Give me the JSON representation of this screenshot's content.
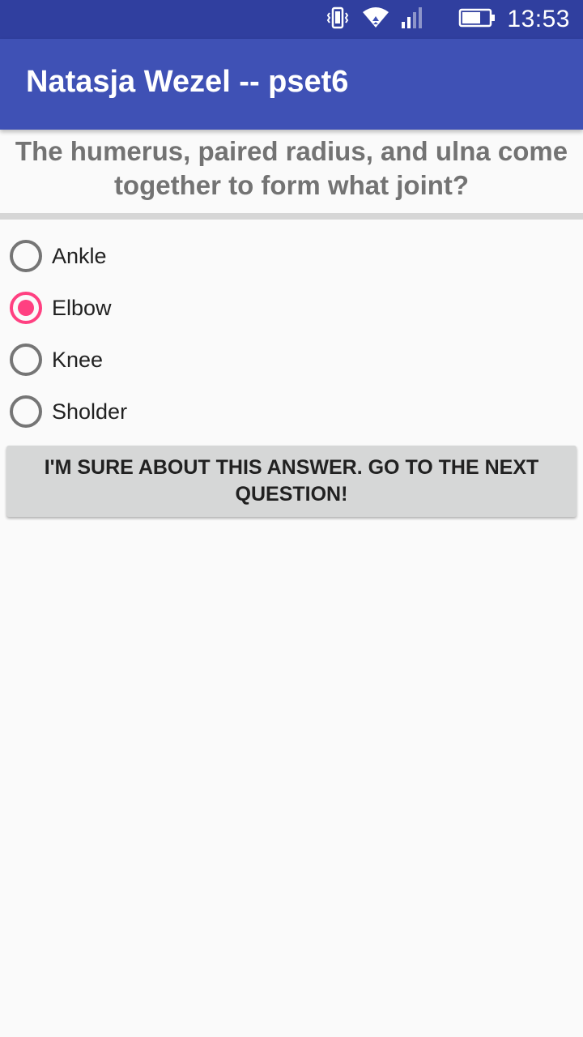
{
  "status_bar": {
    "time": "13:53",
    "icons": [
      "vibrate-icon",
      "wifi-icon",
      "signal-icon",
      "battery-icon"
    ]
  },
  "app_bar": {
    "title": "Natasja Wezel -- pset6"
  },
  "question": {
    "text": "The humerus, paired radius, and ulna come together to form what joint?"
  },
  "options": [
    {
      "label": "Ankle",
      "checked": false
    },
    {
      "label": "Elbow",
      "checked": true
    },
    {
      "label": "Knee",
      "checked": false
    },
    {
      "label": "Sholder",
      "checked": false
    }
  ],
  "next_button": {
    "label": "I'M SURE ABOUT THIS ANSWER. GO TO THE NEXT QUESTION!"
  },
  "colors": {
    "status_bar": "#303f9f",
    "app_bar": "#3f51b5",
    "accent": "#ff4081",
    "background": "#fafafa"
  }
}
